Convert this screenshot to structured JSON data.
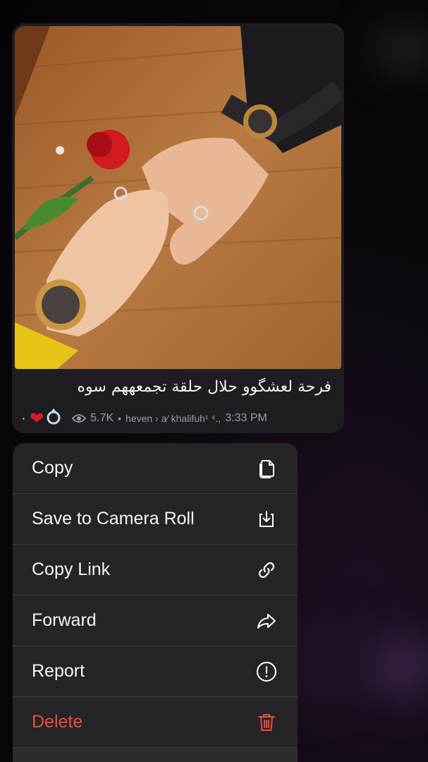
{
  "message": {
    "caption": "فرحة لعشگوو حلال حلقة تجمعههم سوه",
    "reactions": [
      "·",
      "❤",
      "💍"
    ],
    "views": "5.7K",
    "author": "heven › a⁄ khalifuh¹ ⁴.,",
    "time": "3:33 PM"
  },
  "menu": {
    "items": [
      {
        "label": "Copy",
        "icon": "copy-icon"
      },
      {
        "label": "Save to Camera Roll",
        "icon": "download-icon"
      },
      {
        "label": "Copy Link",
        "icon": "link-icon"
      },
      {
        "label": "Forward",
        "icon": "forward-icon"
      },
      {
        "label": "Report",
        "icon": "report-icon"
      },
      {
        "label": "Delete",
        "icon": "trash-icon"
      }
    ]
  },
  "colors": {
    "danger": "#eb4d3d",
    "menu_bg": "#252528"
  }
}
